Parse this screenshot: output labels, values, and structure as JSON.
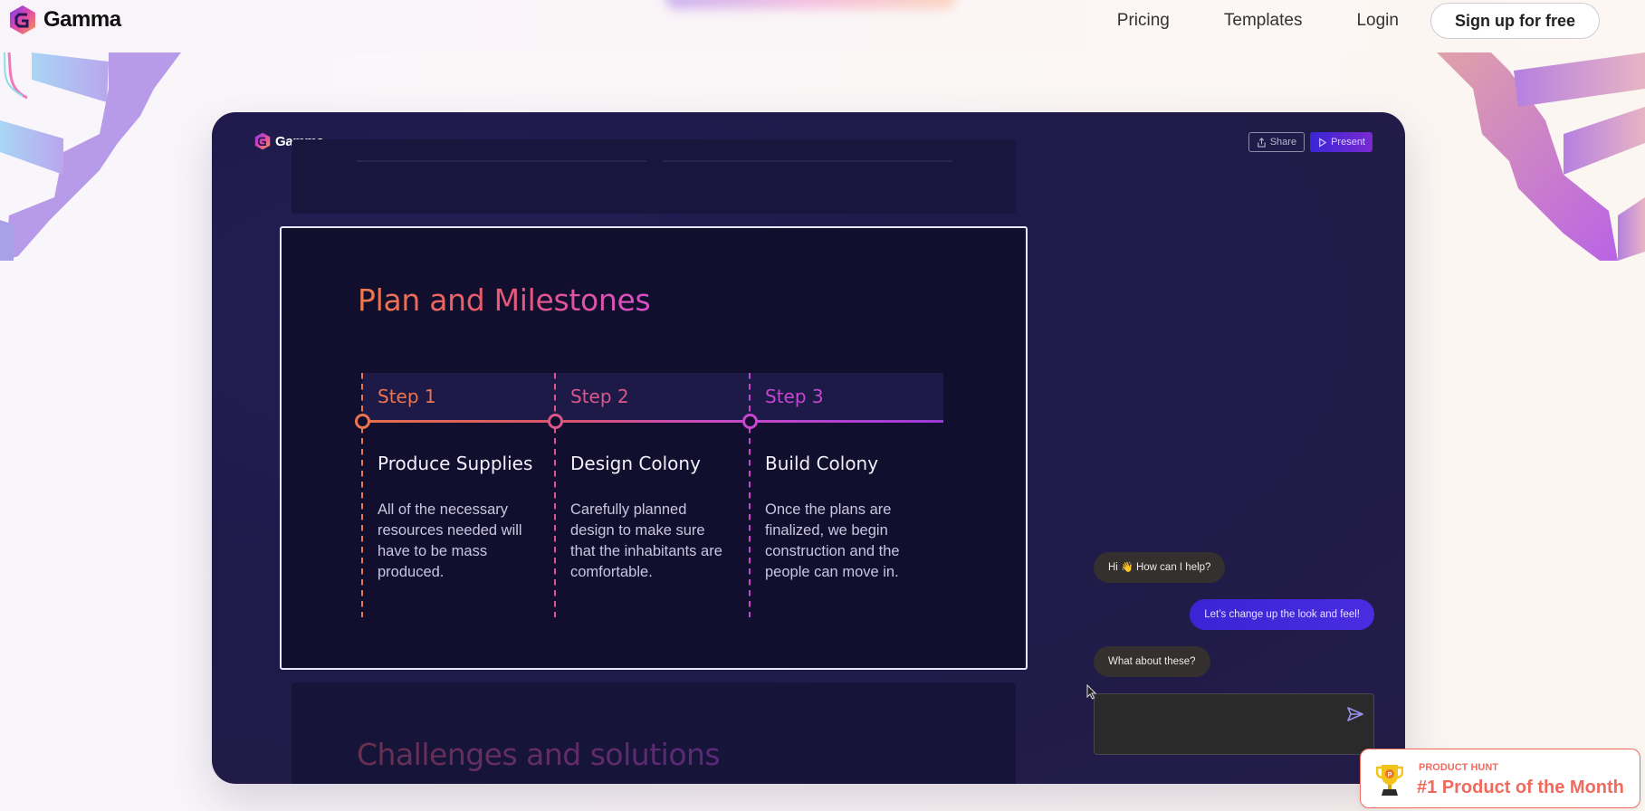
{
  "nav": {
    "brand": "Gamma",
    "links": [
      "Pricing",
      "Templates",
      "Login"
    ],
    "signup_label": "Sign up for free"
  },
  "app": {
    "brand": "Gamma",
    "share_label": "Share",
    "present_label": "Present",
    "slide": {
      "title": "Plan and Milestones",
      "steps": [
        {
          "label": "Step 1",
          "title": "Produce Supplies",
          "text": "All of the necessary resources needed will have to be mass produced.",
          "color": "#ea7550"
        },
        {
          "label": "Step 2",
          "title": "Design Colony",
          "text": "Carefully planned design to make sure that the inhabitants are comfortable.",
          "color": "#d9578a"
        },
        {
          "label": "Step 3",
          "title": "Build Colony",
          "text": "Once the plans are finalized, we begin construction and the people can move in.",
          "color": "#c546d0"
        }
      ]
    },
    "next_slide_title": "Challenges and solutions",
    "chat": {
      "messages": [
        {
          "role": "ai",
          "pre": "Hi",
          "emoji": "👋",
          "text": "How can I help?"
        },
        {
          "role": "user",
          "text": "Let’s change up the look and feel!"
        },
        {
          "role": "ai",
          "text": "What about these?"
        }
      ],
      "input_value": "",
      "input_placeholder": ""
    }
  },
  "badge": {
    "kicker": "PRODUCT HUNT",
    "title": "#1 Product of the Month"
  },
  "colors": {
    "accent_purple": "#4a2de0",
    "badge_red": "#f06a5e",
    "app_bg": "#1f1a4a"
  }
}
